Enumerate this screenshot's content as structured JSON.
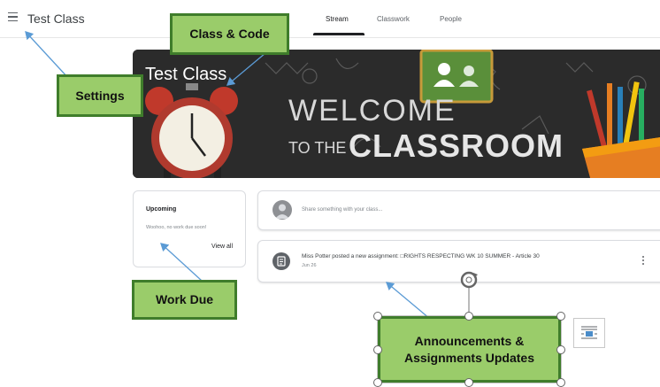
{
  "header": {
    "class_name": "Test Class",
    "tabs": [
      {
        "label": "Stream",
        "active": true
      },
      {
        "label": "Classwork",
        "active": false
      },
      {
        "label": "People",
        "active": false
      }
    ]
  },
  "banner": {
    "class_name": "Test Class",
    "welcome_line1": "WELCOME",
    "welcome_line2_prefix": "TO THE",
    "welcome_line2_main": "CLASSROOM"
  },
  "upcoming": {
    "title": "Upcoming",
    "message": "Woohoo, no work due soon!",
    "view_all": "View all"
  },
  "share": {
    "placeholder": "Share something with your class..."
  },
  "stream": {
    "post_title": "Miss Potter posted a new assignment: □RIGHTS RESPECTING WK 10 SUMMER - Article 30",
    "post_date": "Jun 26"
  },
  "annotations": {
    "class_code": "Class & Code",
    "settings": "Settings",
    "work_due": "Work Due",
    "announcements_line1": "Announcements &",
    "announcements_line2": "Assignments Updates"
  },
  "colors": {
    "callout_fill": "#9acc6a",
    "callout_border": "#3f7d2b",
    "arrow": "#5b9bd5",
    "banner_bg": "#2c2c2c"
  }
}
